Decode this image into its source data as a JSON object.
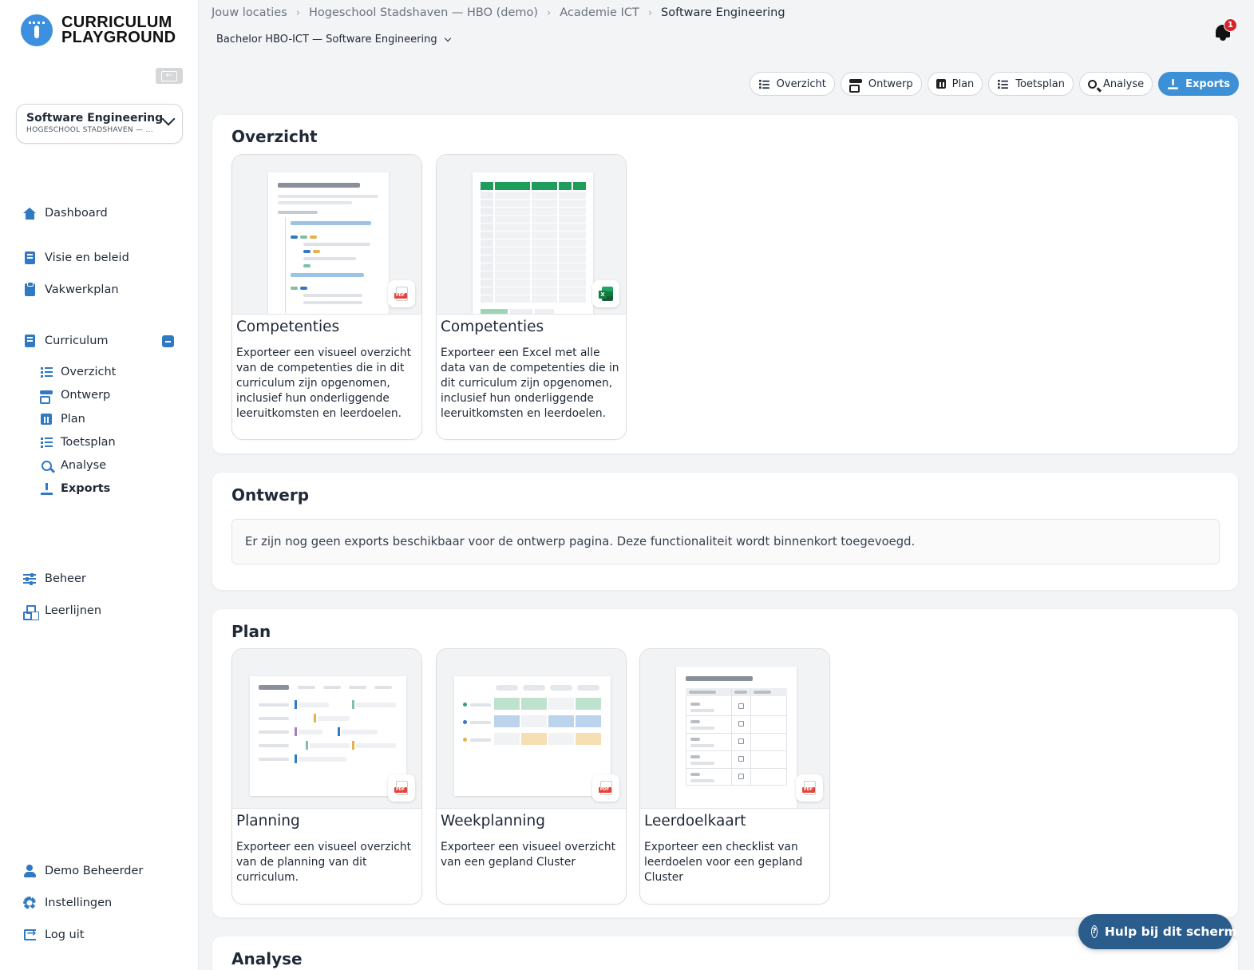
{
  "app": {
    "logo_line1": "CURRICULUM",
    "logo_line2": "PLAYGROUND"
  },
  "program_selector": {
    "title": "Software Engineering",
    "subtitle": "HOGESCHOOL STADSHAVEN — ..."
  },
  "sidebar": {
    "dashboard": "Dashboard",
    "visie": "Visie en beleid",
    "vakwerkplan": "Vakwerkplan",
    "curriculum": "Curriculum",
    "sub": {
      "overzicht": "Overzicht",
      "ontwerp": "Ontwerp",
      "plan": "Plan",
      "toetsplan": "Toetsplan",
      "analyse": "Analyse",
      "exports": "Exports"
    },
    "beheer": "Beheer",
    "leerlijnen": "Leerlijnen",
    "user": "Demo Beheerder",
    "settings": "Instellingen",
    "logout": "Log uit"
  },
  "breadcrumb": {
    "items": [
      "Jouw locaties",
      "Hogeschool Stadshaven — HBO (demo)",
      "Academie ICT",
      "Software Engineering"
    ]
  },
  "curriculum_select": "Bachelor HBO-ICT — Software Engineering",
  "notifications": {
    "count": "1"
  },
  "tabs": {
    "overzicht": "Overzicht",
    "ontwerp": "Ontwerp",
    "plan": "Plan",
    "toetsplan": "Toetsplan",
    "analyse": "Analyse",
    "exports": "Exports"
  },
  "sections": {
    "overzicht": {
      "title": "Overzicht",
      "cards": [
        {
          "title": "Competenties",
          "description": "Exporteer een visueel overzicht van de competenties die in dit curriculum zijn opgenomen, inclusief hun onderliggende leeruitkomsten en leerdoelen.",
          "format": "pdf"
        },
        {
          "title": "Competenties",
          "description": "Exporteer een Excel met alle data van de competenties die in dit curriculum zijn opgenomen, inclusief hun onderliggende leeruitkomsten en leerdoelen.",
          "format": "xlsx"
        }
      ]
    },
    "ontwerp": {
      "title": "Ontwerp",
      "message": "Er zijn nog geen exports beschikbaar voor de ontwerp pagina. Deze functionaliteit wordt binnenkort toegevoegd."
    },
    "plan": {
      "title": "Plan",
      "cards": [
        {
          "title": "Planning",
          "description": "Exporteer een visueel overzicht van de planning van dit curriculum.",
          "format": "pdf"
        },
        {
          "title": "Weekplanning",
          "description": "Exporteer een visueel overzicht van een gepland Cluster",
          "format": "pdf"
        },
        {
          "title": "Leerdoelkaart",
          "description": "Exporteer een checklist van leerdoelen voor een gepland Cluster",
          "format": "pdf"
        }
      ]
    },
    "analyse": {
      "title": "Analyse"
    }
  },
  "help_button": "Hulp bij dit scherm",
  "colors": {
    "accent": "#3d8fd6",
    "nav_icon": "#3279c3",
    "help": "#2b5d8c",
    "badge": "#d9222a"
  }
}
